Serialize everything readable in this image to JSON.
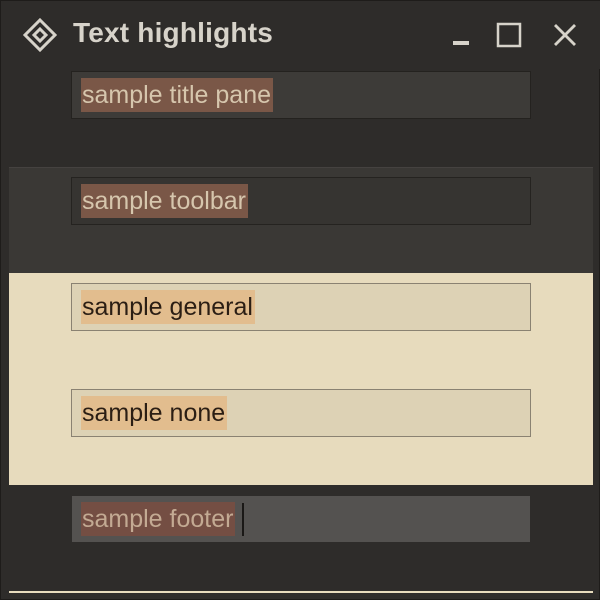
{
  "window": {
    "title": "Text highlights",
    "icon": "diamond-app-icon",
    "controls": [
      "minimize-icon",
      "maximize-icon",
      "close-icon"
    ]
  },
  "samples": {
    "title_pane": "sample title pane",
    "toolbar": "sample toolbar",
    "general": "sample general",
    "none": "sample none",
    "footer": "sample footer"
  },
  "colors": {
    "dark_background": "#2e2c2a",
    "toolbar_background": "#3a3835",
    "general_background": "#e7dbbd",
    "highlight_dark": "#7a5747",
    "highlight_light": "#e2bd8e"
  }
}
